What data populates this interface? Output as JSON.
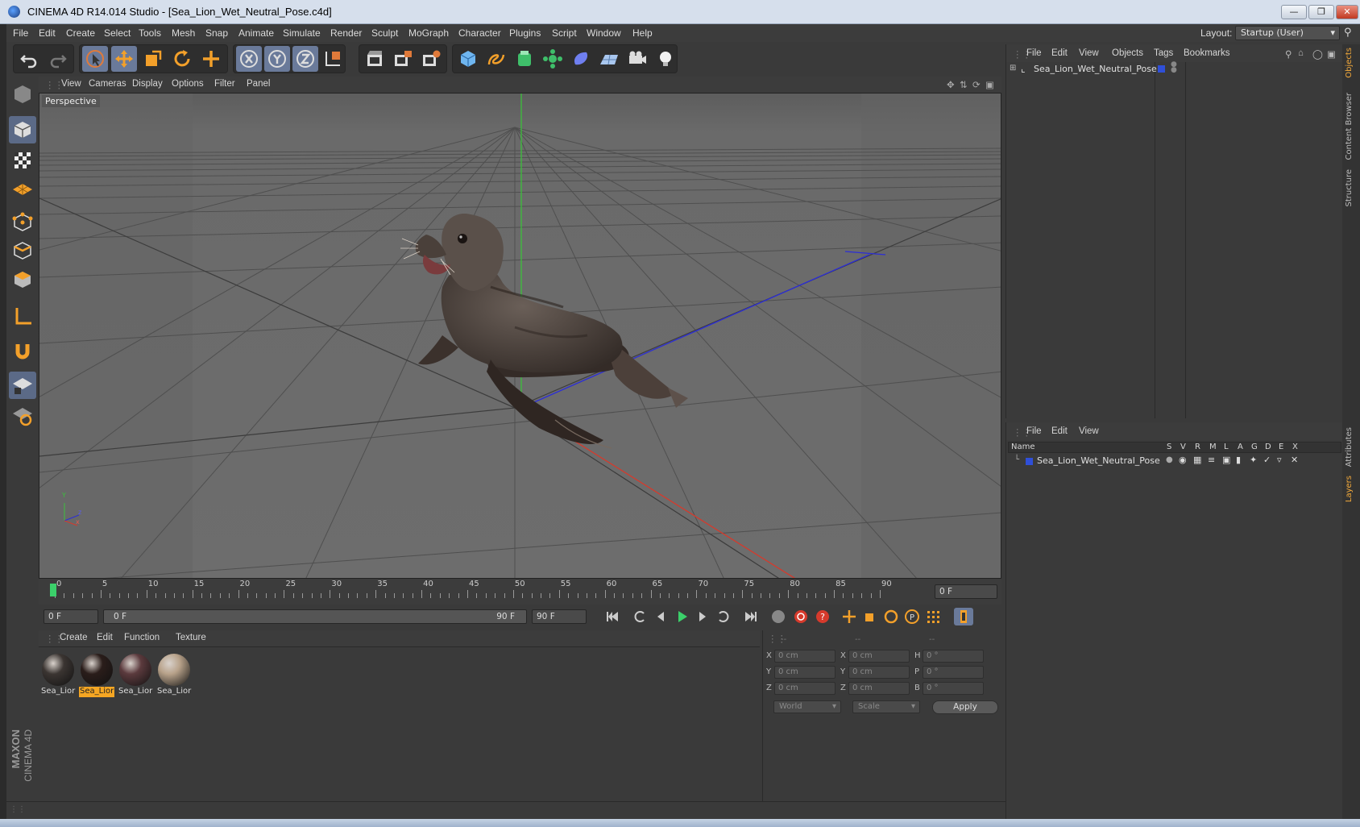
{
  "window": {
    "title": "CINEMA 4D R14.014 Studio - [Sea_Lion_Wet_Neutral_Pose.c4d]",
    "controls": [
      "minimize",
      "restore",
      "close"
    ]
  },
  "menubar": {
    "items": [
      "File",
      "Edit",
      "Create",
      "Select",
      "Tools",
      "Mesh",
      "Snap",
      "Animate",
      "Simulate",
      "Render",
      "Sculpt",
      "MoGraph",
      "Character",
      "Plugins",
      "Script",
      "Window",
      "Help"
    ],
    "layout_label": "Layout:",
    "layout_value": "Startup (User)"
  },
  "toolbar": {
    "icons": [
      "undo-icon",
      "redo-icon",
      "live-selection-icon",
      "move-icon",
      "scale-icon",
      "rotate-icon",
      "add-object-icon",
      "x-axis-icon",
      "y-axis-icon",
      "z-axis-icon",
      "coordinate-system-icon",
      "render-view-icon",
      "render-picture-viewer-icon",
      "render-settings-icon",
      "cube-icon",
      "spline-icon",
      "nurbs-icon",
      "array-icon",
      "deformer-icon",
      "floor-icon",
      "camera-icon",
      "light-icon"
    ]
  },
  "viewport": {
    "menu": [
      "View",
      "Cameras",
      "Display",
      "Options",
      "Filter",
      "Panel"
    ],
    "label": "Perspective",
    "axis": {
      "x": "x",
      "y": "Y",
      "z": "z"
    }
  },
  "timeline": {
    "ticks": [
      "0",
      "5",
      "10",
      "15",
      "20",
      "25",
      "30",
      "35",
      "40",
      "45",
      "50",
      "55",
      "60",
      "65",
      "70",
      "75",
      "80",
      "85",
      "90"
    ],
    "current_frame": "0 F",
    "start_field": "0 F",
    "range_start": "0 F",
    "range_end": "90 F",
    "end_field": "90 F"
  },
  "materials": {
    "menu": [
      "Create",
      "Edit",
      "Function",
      "Texture"
    ],
    "items": [
      {
        "label": "Sea_Lior",
        "color": "#3b3532"
      },
      {
        "label": "Sea_Lior",
        "color": "#2a1d1a"
      },
      {
        "label": "Sea_Lior",
        "color": "#5b3a3d"
      },
      {
        "label": "Sea_Lior",
        "color": "#b8a28a"
      }
    ],
    "selected_index": 1
  },
  "coordinates": {
    "headers": [
      "--",
      "--",
      "--"
    ],
    "rows": [
      {
        "l1": "X",
        "v1": "0 cm",
        "l2": "X",
        "v2": "0 cm",
        "l3": "H",
        "v3": "0 °"
      },
      {
        "l1": "Y",
        "v1": "0 cm",
        "l2": "Y",
        "v2": "0 cm",
        "l3": "P",
        "v3": "0 °"
      },
      {
        "l1": "Z",
        "v1": "0 cm",
        "l2": "Z",
        "v2": "0 cm",
        "l3": "B",
        "v3": "0 °"
      }
    ],
    "mode1": "World",
    "mode2": "Scale",
    "apply_label": "Apply"
  },
  "objects_panel": {
    "menu": [
      "File",
      "Edit",
      "View",
      "Objects",
      "Tags",
      "Bookmarks"
    ],
    "object_name": "Sea_Lion_Wet_Neutral_Pose",
    "layer_color": "#2f4fd8"
  },
  "layers_panel": {
    "menu": [
      "File",
      "Edit",
      "View"
    ],
    "columns": [
      "Name",
      "S",
      "V",
      "R",
      "M",
      "L",
      "A",
      "G",
      "D",
      "E",
      "X"
    ],
    "layer_name": "Sea_Lion_Wet_Neutral_Pose",
    "layer_color": "#2f4fd8"
  },
  "right_tabs": [
    "Objects",
    "Content Browser",
    "Structure",
    "Attributes",
    "Layers"
  ],
  "brand": {
    "line1": "MAXON",
    "line2": "CINEMA 4D"
  }
}
